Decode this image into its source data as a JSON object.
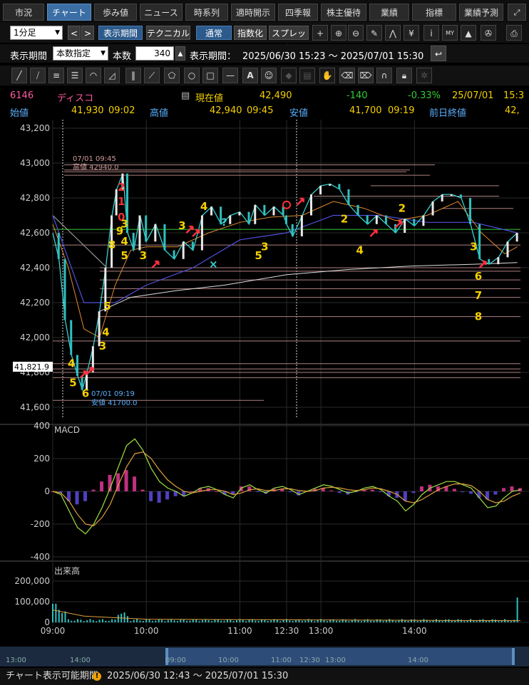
{
  "tabs": [
    {
      "label": "市況",
      "active": false
    },
    {
      "label": "チャート",
      "active": true
    },
    {
      "label": "歩み値",
      "active": false
    },
    {
      "label": "ニュース",
      "active": false
    },
    {
      "label": "時系列",
      "active": false
    },
    {
      "label": "適時開示",
      "active": false
    },
    {
      "label": "四季報",
      "active": false
    },
    {
      "label": "株主優待",
      "active": false
    },
    {
      "label": "業績",
      "active": false
    },
    {
      "label": "指標",
      "active": false
    },
    {
      "label": "業績予測",
      "active": false
    }
  ],
  "toolbar": {
    "interval": "1分足",
    "prev": "<",
    "next": ">",
    "period_btn": "表示期間",
    "technical_btn": "テクニカル",
    "normal_btn": "通常",
    "index_btn": "指数化",
    "spread_btn": "スプレッド",
    "plus": "+",
    "yen": "¥",
    "info_glyph": "i",
    "my": "MY"
  },
  "period_bar": {
    "label": "表示期間",
    "mode": "本数指定",
    "count_label": "本数",
    "count": "340",
    "range_label": "表示期間：",
    "range": "2025/06/30 15:23 ～ 2025/07/01 15:30"
  },
  "stock": {
    "code": "6146",
    "name": "ディスコ",
    "current_label": "現在値",
    "current": "42,490",
    "change": "-140",
    "change_pct": "-0.33%",
    "date": "25/07/01",
    "time": "15:3",
    "open_label": "始値",
    "open": "41,930",
    "open_time": "09:02",
    "high_label": "高値",
    "high": "42,940",
    "high_time": "09:45",
    "low_label": "安値",
    "low": "41,700",
    "low_time": "09:19",
    "prev_close_label": "前日終値",
    "prev_close": "42,"
  },
  "chart_data": {
    "type": "line",
    "price_ticks": [
      "43,200",
      "43,000",
      "42,800",
      "42,600",
      "42,400",
      "42,200",
      "42,000",
      "41,800",
      "41,600"
    ],
    "price_tick_values": [
      43200,
      43000,
      42800,
      42600,
      42400,
      42200,
      42000,
      41800,
      41600
    ],
    "current_price_tag": "41,821.9",
    "annotations": {
      "high": "07/01 09:45\n高値 42940.0",
      "high_l1": "07/01 09:45",
      "high_l2": "高値 42940.0",
      "low_l1": "07/01 09:19",
      "low_l2": "安値 41700.0"
    },
    "macd_label": "MACD",
    "macd_ticks": [
      "400",
      "200",
      "0",
      "-200",
      "-400"
    ],
    "macd_tick_values": [
      400,
      200,
      0,
      -200,
      -400
    ],
    "volume_label": "出来高",
    "volume_ticks": [
      "200,000",
      "100,000",
      "0"
    ],
    "volume_tick_values": [
      200000,
      100000,
      0
    ],
    "time_ticks": [
      "09:00",
      "10:00",
      "11:00",
      "12:30",
      "13:00",
      "14:00"
    ],
    "price_series": [
      {
        "t": 0,
        "v": 42600
      },
      {
        "t": 4,
        "v": 42450
      },
      {
        "t": 8,
        "v": 42100
      },
      {
        "t": 12,
        "v": 41900
      },
      {
        "t": 16,
        "v": 41780
      },
      {
        "t": 19,
        "v": 41700
      },
      {
        "t": 22,
        "v": 41800
      },
      {
        "t": 26,
        "v": 41950
      },
      {
        "t": 30,
        "v": 42150
      },
      {
        "t": 34,
        "v": 42400
      },
      {
        "t": 38,
        "v": 42700
      },
      {
        "t": 41,
        "v": 42850
      },
      {
        "t": 45,
        "v": 42940
      },
      {
        "t": 48,
        "v": 42600
      },
      {
        "t": 52,
        "v": 42500
      },
      {
        "t": 56,
        "v": 42700
      },
      {
        "t": 60,
        "v": 42550
      },
      {
        "t": 66,
        "v": 42650
      },
      {
        "t": 72,
        "v": 42500
      },
      {
        "t": 78,
        "v": 42450
      },
      {
        "t": 84,
        "v": 42550
      },
      {
        "t": 90,
        "v": 42500
      },
      {
        "t": 96,
        "v": 42700
      },
      {
        "t": 102,
        "v": 42750
      },
      {
        "t": 108,
        "v": 42650
      },
      {
        "t": 114,
        "v": 42700
      },
      {
        "t": 120,
        "v": 42720
      },
      {
        "t": 126,
        "v": 42650
      },
      {
        "t": 130,
        "v": 42760
      },
      {
        "t": 136,
        "v": 42700
      },
      {
        "t": 142,
        "v": 42750
      },
      {
        "t": 148,
        "v": 42700
      },
      {
        "t": 150,
        "v": 42650
      },
      {
        "t": 154,
        "v": 42580
      },
      {
        "t": 160,
        "v": 42700
      },
      {
        "t": 166,
        "v": 42820
      },
      {
        "t": 172,
        "v": 42870
      },
      {
        "t": 178,
        "v": 42880
      },
      {
        "t": 184,
        "v": 42850
      },
      {
        "t": 190,
        "v": 42760
      },
      {
        "t": 196,
        "v": 42700
      },
      {
        "t": 202,
        "v": 42650
      },
      {
        "t": 208,
        "v": 42700
      },
      {
        "t": 214,
        "v": 42650
      },
      {
        "t": 220,
        "v": 42600
      },
      {
        "t": 226,
        "v": 42680
      },
      {
        "t": 232,
        "v": 42640
      },
      {
        "t": 238,
        "v": 42700
      },
      {
        "t": 244,
        "v": 42780
      },
      {
        "t": 250,
        "v": 42820
      },
      {
        "t": 256,
        "v": 42820
      },
      {
        "t": 262,
        "v": 42800
      },
      {
        "t": 268,
        "v": 42650
      },
      {
        "t": 274,
        "v": 42450
      },
      {
        "t": 280,
        "v": 42420
      },
      {
        "t": 286,
        "v": 42460
      },
      {
        "t": 292,
        "v": 42550
      },
      {
        "t": 298,
        "v": 42600
      }
    ],
    "ma_series": [
      {
        "t": 0,
        "v": 42650
      },
      {
        "t": 10,
        "v": 42400
      },
      {
        "t": 20,
        "v": 42050
      },
      {
        "t": 30,
        "v": 42000
      },
      {
        "t": 40,
        "v": 42300
      },
      {
        "t": 50,
        "v": 42500
      },
      {
        "t": 60,
        "v": 42520
      },
      {
        "t": 80,
        "v": 42520
      },
      {
        "t": 100,
        "v": 42600
      },
      {
        "t": 120,
        "v": 42660
      },
      {
        "t": 140,
        "v": 42690
      },
      {
        "t": 160,
        "v": 42700
      },
      {
        "t": 180,
        "v": 42780
      },
      {
        "t": 200,
        "v": 42740
      },
      {
        "t": 220,
        "v": 42670
      },
      {
        "t": 240,
        "v": 42700
      },
      {
        "t": 260,
        "v": 42780
      },
      {
        "t": 275,
        "v": 42600
      },
      {
        "t": 290,
        "v": 42480
      },
      {
        "t": 298,
        "v": 42520
      }
    ],
    "ma_long_series": [
      {
        "t": 0,
        "v": 42700
      },
      {
        "t": 20,
        "v": 42200
      },
      {
        "t": 40,
        "v": 42200
      },
      {
        "t": 60,
        "v": 42300
      },
      {
        "t": 90,
        "v": 42400
      },
      {
        "t": 120,
        "v": 42560
      },
      {
        "t": 150,
        "v": 42600
      },
      {
        "t": 180,
        "v": 42700
      },
      {
        "t": 210,
        "v": 42700
      },
      {
        "t": 240,
        "v": 42660
      },
      {
        "t": 270,
        "v": 42660
      },
      {
        "t": 298,
        "v": 42600
      }
    ],
    "vwap_series": [
      {
        "t": 30,
        "v": 42150
      },
      {
        "t": 50,
        "v": 42230
      },
      {
        "t": 80,
        "v": 42270
      },
      {
        "t": 110,
        "v": 42300
      },
      {
        "t": 150,
        "v": 42360
      },
      {
        "t": 190,
        "v": 42390
      },
      {
        "t": 230,
        "v": 42410
      },
      {
        "t": 270,
        "v": 42420
      },
      {
        "t": 298,
        "v": 42430
      }
    ],
    "count_labels": [
      {
        "text": "2",
        "t": 44,
        "v": 42840,
        "color": "#e33"
      },
      {
        "text": "1",
        "t": 44,
        "v": 42760,
        "color": "#e33"
      },
      {
        "text": "0",
        "t": 44,
        "v": 42670,
        "color": "#e33"
      },
      {
        "text": "9",
        "t": 43,
        "v": 42590,
        "color": "#f5d000"
      },
      {
        "text": "3",
        "t": 46,
        "v": 42630,
        "color": "#f5d000"
      },
      {
        "text": "4",
        "t": 46,
        "v": 42530,
        "color": "#f5d000"
      },
      {
        "text": "5",
        "t": 46,
        "v": 42450,
        "color": "#f5d000"
      },
      {
        "text": "8",
        "t": 38,
        "v": 42510,
        "color": "#f5d000"
      },
      {
        "text": "5",
        "t": 35,
        "v": 42160,
        "color": "#f5d000"
      },
      {
        "text": "4",
        "t": 34,
        "v": 42010,
        "color": "#f5d000"
      },
      {
        "text": "3",
        "t": 32,
        "v": 41930,
        "color": "#f5d000"
      },
      {
        "text": "4",
        "t": 12,
        "v": 41830,
        "color": "#f5d000"
      },
      {
        "text": "5",
        "t": 13,
        "v": 41720,
        "color": "#f5d000"
      },
      {
        "text": "6",
        "t": 21,
        "v": 41660,
        "color": "#f5d000"
      },
      {
        "text": "3",
        "t": 58,
        "v": 42450,
        "color": "#f5d000"
      },
      {
        "text": "3",
        "t": 83,
        "v": 42620,
        "color": "#f5d000"
      },
      {
        "text": "4",
        "t": 97,
        "v": 42730,
        "color": "#f5d000"
      },
      {
        "text": "5",
        "t": 132,
        "v": 42450,
        "color": "#f5d000"
      },
      {
        "text": "3",
        "t": 136,
        "v": 42500,
        "color": "#f5d000"
      },
      {
        "text": "2",
        "t": 187,
        "v": 42660,
        "color": "#f5d000"
      },
      {
        "text": "4",
        "t": 197,
        "v": 42480,
        "color": "#f5d000"
      },
      {
        "text": "2",
        "t": 224,
        "v": 42720,
        "color": "#f5d000"
      },
      {
        "text": "3",
        "t": 270,
        "v": 42500,
        "color": "#f5d000"
      },
      {
        "text": "6",
        "t": 273,
        "v": 42330,
        "color": "#f5d000"
      },
      {
        "text": "7",
        "t": 273,
        "v": 42220,
        "color": "#f5d000"
      },
      {
        "text": "8",
        "t": 273,
        "v": 42100,
        "color": "#f5d000"
      }
    ]
  },
  "navigator": {
    "times": [
      "13:00",
      "14:00",
      "09:00",
      "10:00",
      "11:00",
      "12:30",
      "13:00",
      "14:00"
    ]
  },
  "footer": {
    "label": "チャート表示可能期間",
    "range": "2025/06/30 12:43 ～ 2025/07/01 15:30"
  },
  "colors": {
    "accent": "#3a6ea5",
    "up": "#3ad0d0",
    "negative_change": "#33cc33",
    "yellow_text": "#f5d000",
    "code": "#ff5aa0"
  }
}
